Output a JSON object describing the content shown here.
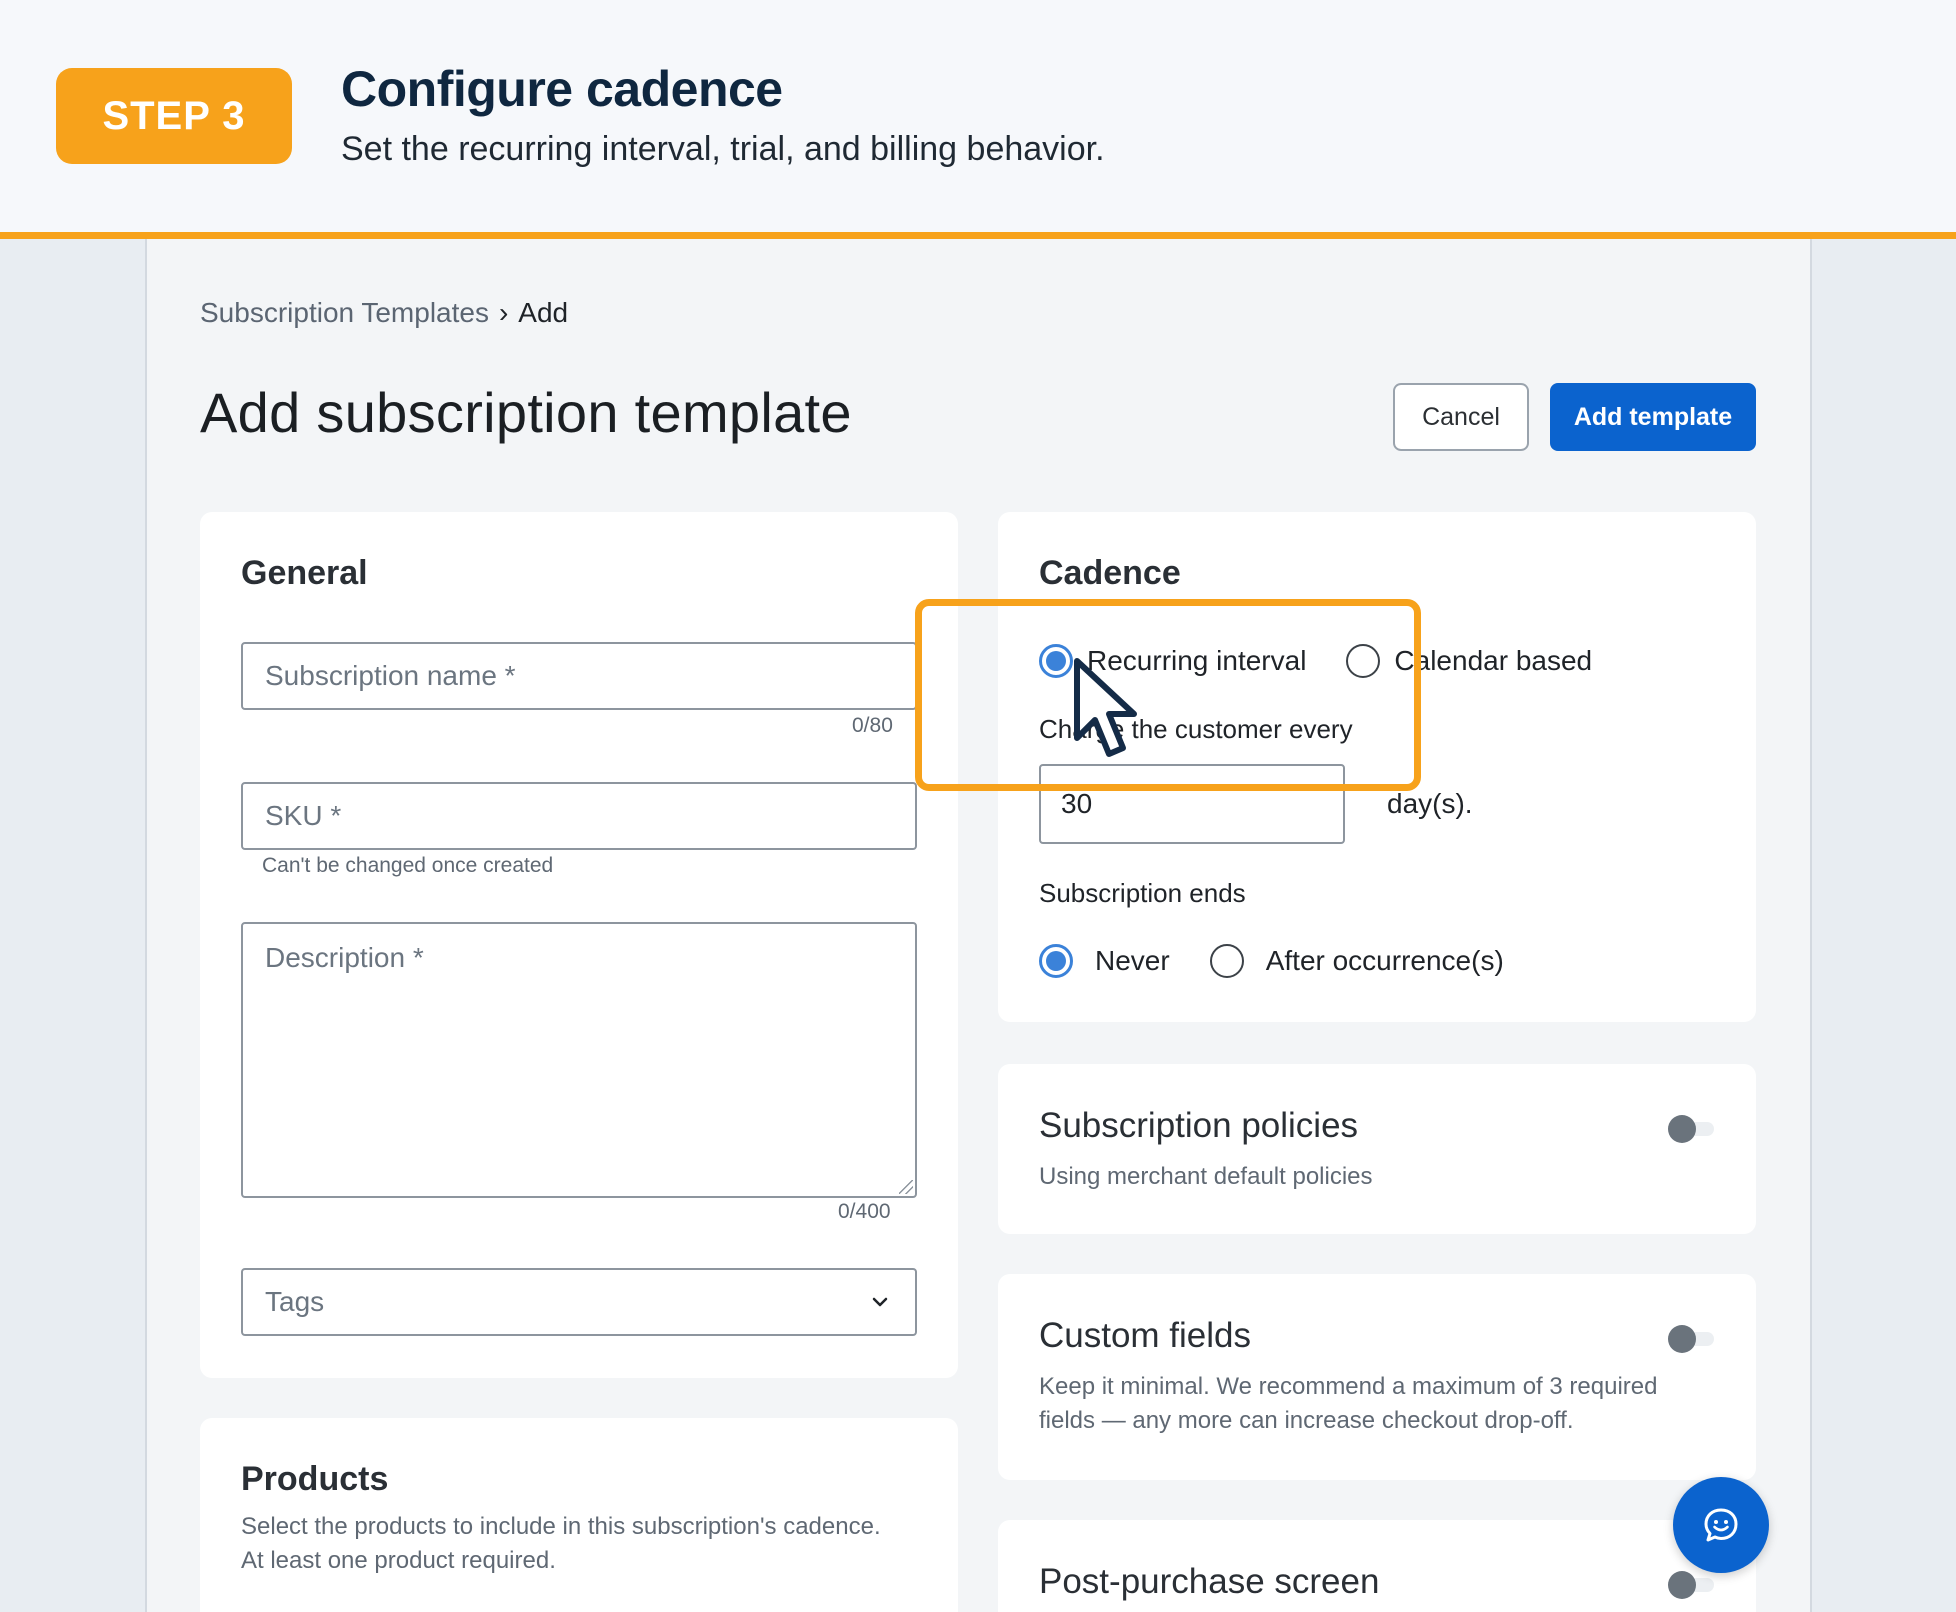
{
  "banner": {
    "step_label": "STEP 3",
    "title": "Configure cadence",
    "subtitle": "Set the recurring interval, trial, and billing behavior."
  },
  "breadcrumb": {
    "parent": "Subscription Templates",
    "separator": "›",
    "current": "Add"
  },
  "page": {
    "title": "Add subscription template",
    "cancel_label": "Cancel",
    "add_label": "Add template"
  },
  "general": {
    "heading": "General",
    "name_placeholder": "Subscription name *",
    "name_counter": "0/80",
    "sku_placeholder": "SKU *",
    "sku_helper": "Can't be changed once created",
    "description_placeholder": "Description *",
    "description_counter": "0/400",
    "tags_placeholder": "Tags"
  },
  "products": {
    "heading": "Products",
    "description": "Select the products to include in this subscription's cadence. At least one product required."
  },
  "cadence": {
    "heading": "Cadence",
    "type_options": [
      {
        "label": "Recurring interval",
        "checked": true
      },
      {
        "label": "Calendar based",
        "checked": false
      }
    ],
    "charge_label": "Charge the customer every",
    "interval_value": "30",
    "interval_unit": "day(s).",
    "ends_label": "Subscription ends",
    "ends_options": [
      {
        "label": "Never",
        "checked": true
      },
      {
        "label": "After occurrence(s)",
        "checked": false
      }
    ]
  },
  "policies": {
    "heading": "Subscription policies",
    "description": "Using merchant default policies",
    "enabled": false
  },
  "custom_fields": {
    "heading": "Custom fields",
    "description": "Keep it minimal. We recommend a maximum of 3 required fields — any more can increase checkout drop-off.",
    "enabled": false
  },
  "post_purchase": {
    "heading": "Post-purchase screen",
    "enabled": false
  },
  "icons": {
    "chevron": "chevron-down-icon",
    "chat": "chat-bubble-icon",
    "cursor": "mouse-pointer-icon"
  },
  "colors": {
    "accent": "#f7a21b",
    "primary": "#0b63ce",
    "radio": "#3b82d9"
  }
}
